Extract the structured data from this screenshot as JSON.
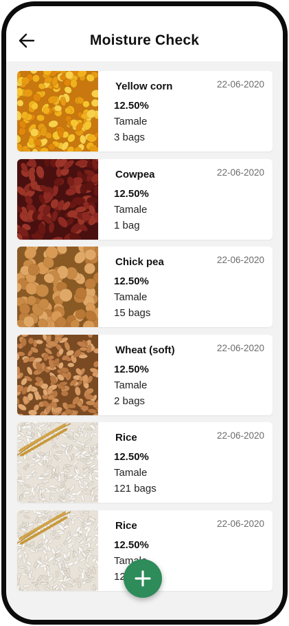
{
  "header": {
    "title": "Moisture Check",
    "back_icon": "arrow-left-icon"
  },
  "items": [
    {
      "name": "Yellow corn",
      "date": "22-06-2020",
      "moisture": "12.50%",
      "location": "Tamale",
      "bags": "3 bags",
      "image": "corn"
    },
    {
      "name": "Cowpea",
      "date": "22-06-2020",
      "moisture": "12.50%",
      "location": "Tamale",
      "bags": "1 bag",
      "image": "cowpea"
    },
    {
      "name": "Chick pea",
      "date": "22-06-2020",
      "moisture": "12.50%",
      "location": "Tamale",
      "bags": "15 bags",
      "image": "chickpea"
    },
    {
      "name": "Wheat (soft)",
      "date": "22-06-2020",
      "moisture": "12.50%",
      "location": "Tamale",
      "bags": "2 bags",
      "image": "wheat"
    },
    {
      "name": "Rice",
      "date": "22-06-2020",
      "moisture": "12.50%",
      "location": "Tamale",
      "bags": "121 bags",
      "image": "rice"
    },
    {
      "name": "Rice",
      "date": "22-06-2020",
      "moisture": "12.50%",
      "location": "Tamale",
      "bags": "121 bags",
      "image": "rice"
    }
  ],
  "fab": {
    "icon": "plus-icon"
  },
  "colors": {
    "accent": "#2e8b5a",
    "background": "#f2f2f2"
  }
}
